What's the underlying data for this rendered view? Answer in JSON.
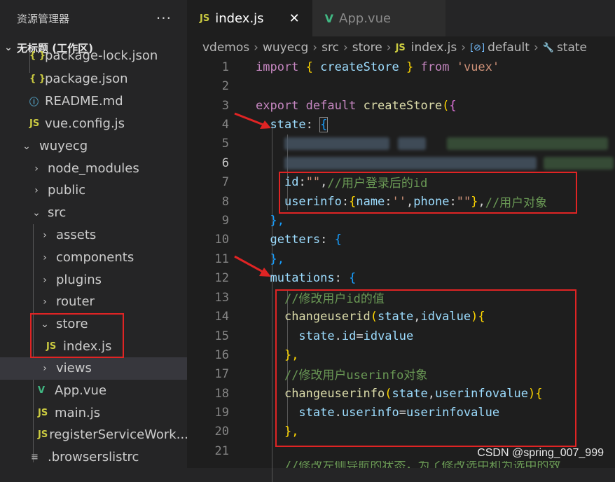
{
  "sidebar": {
    "title": "资源管理器",
    "more": "···",
    "workspace": "无标题 (工作区)",
    "items": [
      {
        "label": "package-lock.json",
        "icon": "{ }"
      },
      {
        "label": "package.json",
        "icon": "{ }"
      },
      {
        "label": "README.md",
        "icon": "ⓘ"
      },
      {
        "label": "vue.config.js",
        "icon": "JS"
      },
      {
        "label": "wuyecg",
        "icon": ""
      },
      {
        "label": "node_modules",
        "icon": ""
      },
      {
        "label": "public",
        "icon": ""
      },
      {
        "label": "src",
        "icon": ""
      },
      {
        "label": "assets",
        "icon": ""
      },
      {
        "label": "components",
        "icon": ""
      },
      {
        "label": "plugins",
        "icon": ""
      },
      {
        "label": "router",
        "icon": ""
      },
      {
        "label": "store",
        "icon": ""
      },
      {
        "label": "index.js",
        "icon": "JS"
      },
      {
        "label": "views",
        "icon": ""
      },
      {
        "label": "App.vue",
        "icon": "V"
      },
      {
        "label": "main.js",
        "icon": "JS"
      },
      {
        "label": "registerServiceWork...",
        "icon": "JS"
      },
      {
        "label": ".browserslistrc",
        "icon": "≡"
      }
    ]
  },
  "tabs": [
    {
      "label": "index.js",
      "icon": "JS",
      "close": "✕"
    },
    {
      "label": "App.vue",
      "icon": "V"
    }
  ],
  "breadcrumb": [
    "vdemos",
    "wuyecg",
    "src",
    "store",
    "index.js",
    "default",
    "state"
  ],
  "breadcrumb_icons": {
    "file": "JS",
    "default": "[⊘]",
    "state": "🔧"
  },
  "code": {
    "line_numbers": [
      "1",
      "2",
      "3",
      "4",
      "5",
      "6",
      "7",
      "8",
      "9",
      "10",
      "11",
      "12",
      "13",
      "14",
      "15",
      "16",
      "17",
      "18",
      "19",
      "20",
      "21"
    ],
    "l1": {
      "import": "import",
      "ob": "{",
      "name": "createStore",
      "cb": "}",
      "from": "from",
      "str": "'vuex'"
    },
    "l3": {
      "export": "export",
      "default": "default",
      "fn": "createStore",
      "paren": "(",
      "brace": "{"
    },
    "l4": {
      "key": "state",
      "colon": ":",
      "brace": "{"
    },
    "l7": {
      "key": "id",
      "colon": ":",
      "val": "\"\"",
      "comma": ",",
      "comment": "//用户登录后的id"
    },
    "l8": {
      "key": "userinfo",
      "colon": ":",
      "ob": "{",
      "k1": "name",
      "v1": "''",
      "k2": "phone",
      "v2": "\"\"",
      "cb": "}",
      "comma": ",",
      "comment": "//用户对象"
    },
    "l9": {
      "close": "},"
    },
    "l10": {
      "key": "getters",
      "colon": ":",
      "brace": "{"
    },
    "l11": {
      "close": "},"
    },
    "l12": {
      "key": "mutations",
      "colon": ":",
      "brace": "{"
    },
    "l13": {
      "comment": "//修改用户id的值"
    },
    "l14": {
      "fn": "changeuserid",
      "op": "(",
      "a1": "state",
      "comma": ",",
      "a2": "idvalue",
      "cp": ")",
      "ob": "{"
    },
    "l15": {
      "obj": "state",
      "dot": ".",
      "prop": "id",
      "eq": "=",
      "val": "idvalue"
    },
    "l16": {
      "close": "},"
    },
    "l17": {
      "comment": "//修改用户userinfo对象"
    },
    "l18": {
      "fn": "changeuserinfo",
      "op": "(",
      "a1": "state",
      "comma": ",",
      "a2": "userinfovalue",
      "cp": ")",
      "ob": "{"
    },
    "l19": {
      "obj": "state",
      "dot": ".",
      "prop": "userinfo",
      "eq": "=",
      "val": "userinfovalue"
    },
    "l20": {
      "close": "},"
    },
    "l22": {
      "comment": "//修改左侧导航的状态，为了修改选中和为选中的效"
    }
  },
  "watermark": "CSDN @spring_007_999",
  "colors": {
    "keyword": "#c586c0",
    "function": "#dcdcaa",
    "string": "#ce9178",
    "property": "#9cdcfe",
    "comment": "#6a9955",
    "highlight_box": "#e02424"
  }
}
